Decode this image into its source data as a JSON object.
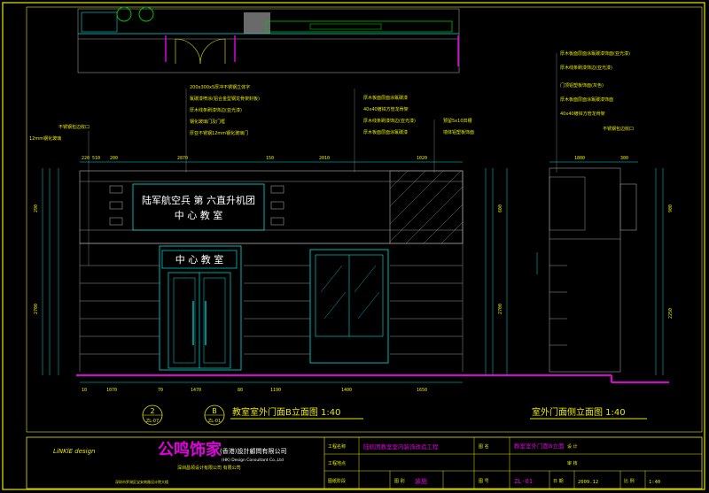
{
  "colors": {
    "background": "#000000",
    "frame": "#e8e800",
    "cyan": "#00e0e0",
    "magenta": "#e000e0",
    "white": "#ffffff",
    "green": "#00c000",
    "grey": "#9a9a9a",
    "yellow_text": "#e8e800"
  },
  "main_elevation": {
    "title": "教室室外门面B立面图 1:40",
    "sign_upper_line1": "陆军航空兵 第 六直升机团",
    "sign_upper_line2": "中 心 教 室",
    "sign_lower": "中 心 教 室",
    "top_dims": [
      "220",
      "510",
      "200",
      "2870",
      "150",
      "2010",
      "1020"
    ],
    "bottom_dims": [
      "10",
      "1070",
      "70",
      "1470",
      "80",
      "1190",
      "1400",
      "1650"
    ],
    "left_dims": [
      "290",
      "2700"
    ],
    "right_dims": [
      "600",
      "2700"
    ],
    "callouts_left": [
      "200x300x5厚冲不锈钢立体字",
      "氟碳漆喷涂(铝合金型钢龙骨架封板)",
      "厚木线条刷漆饰边(亚光漆)",
      "钢化玻璃门及门框",
      "厚亚不锈钢12mm钢化玻璃门"
    ],
    "callouts_mid": [
      "厚木板面层面涂氟碳漆",
      "40x40镀锌方管龙骨架",
      "厚木线条刷漆饰边(亚光漆)",
      "厚木板面层面涂氟碳漆"
    ],
    "callouts_right": [
      "预留5x10凹槽",
      "墙体铝塑板饰面"
    ],
    "callout_far_left": [
      "不锈钢包边收口",
      "12mm钢化玻璃"
    ],
    "callout_labels": [
      {
        "code": "2",
        "sheet": "ZL-07"
      },
      {
        "code": "B",
        "sheet": "ZL-01"
      }
    ]
  },
  "side_elevation": {
    "title": "室外门面侧立面图 1:40",
    "top_dims": [
      "1800",
      "300"
    ],
    "right_dims": [
      "900",
      "2250"
    ],
    "callouts": [
      "厚木板面层面涂氟碳漆饰面(亚光漆)",
      "厚木线条刷漆饰边(亚光漆)",
      "门顶铝塑板饰面(灰色)",
      "厚木板面层面涂氟碳漆饰面",
      "40x40镀锌方管龙骨架",
      "不锈钢包边收口"
    ]
  },
  "title_block": {
    "brand_latin": "LiNKlE design",
    "brand_cn": "公鸣饰家",
    "company_line1": "(香港)設計顧問有限公司",
    "company_line2": "(HK) Design Consultant Co.,Ltd",
    "company_line3": "深圳昌领设计有限公司 有限公司",
    "company_footer": "深圳市罗湖区宝安南路设计院大楼",
    "project_label": "工程名称",
    "project_value": "陆航团教室室内装饰改造工程",
    "drawing_label": "图 名",
    "drawing_value": "教室室外门面B立面",
    "design_label": "设 计",
    "area_label": "工程地点",
    "check_label": "审 核",
    "stage_label": "图纸阶段",
    "sheet_type_label": "图 别",
    "sheet_type_value": "装施",
    "number_label": "图 号",
    "number_value": "ZL-01",
    "date_label": "日 期",
    "date_value": "2009.12",
    "scale_label": "比 例",
    "scale_value": "1:40"
  }
}
